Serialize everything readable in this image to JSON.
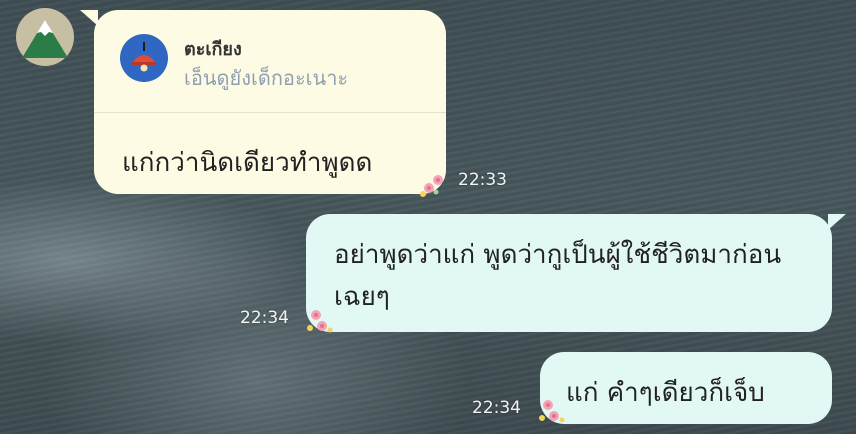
{
  "chat": {
    "contact_avatar_icon": "mountain-avatar-icon",
    "messages": [
      {
        "direction": "incoming",
        "reply_to": {
          "icon": "lamp-icon",
          "name": "ตะเกียง",
          "preview": "เอ็นดูยังเด็กอะเนาะ"
        },
        "text": "แก่กว่านิดเดียวทำพูดด",
        "time": "22:33"
      },
      {
        "direction": "outgoing",
        "text": "อย่าพูดว่าแก่ พูดว่ากูเป็นผู้ใช้ชีวิตมาก่อนเฉยๆ",
        "time": "22:34"
      },
      {
        "direction": "outgoing",
        "text": "แก่ คำๆเดียวก็เจ็บ",
        "time": "22:34"
      }
    ],
    "colors": {
      "incoming_bubble": "#fdfbe3",
      "outgoing_bubble": "#e2f8f4",
      "reply_icon_bg": "#2f67c2"
    }
  }
}
